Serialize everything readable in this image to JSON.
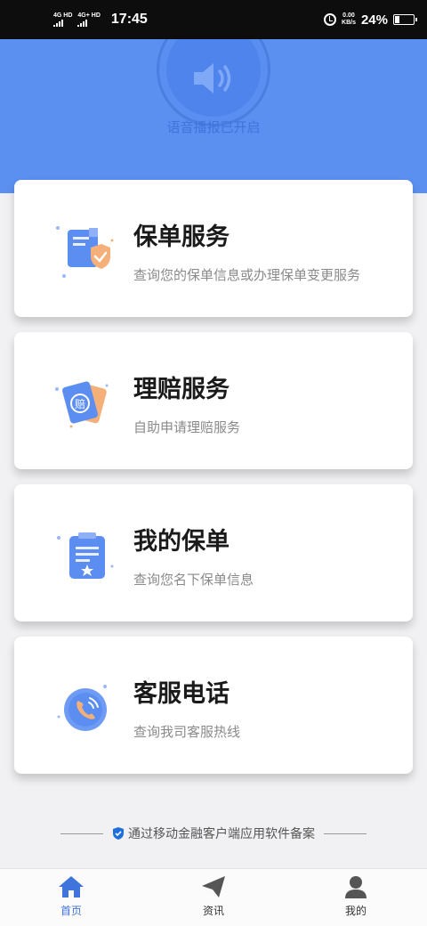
{
  "status_bar": {
    "signal1": "4G HD",
    "signal2": "4G+ HD",
    "time": "17:45",
    "net_speed_value": "0.00",
    "net_speed_unit": "KB/s",
    "battery": "24%",
    "battery_level": 0.24
  },
  "header": {
    "voice_status": "语音播报已开启",
    "icon": "speaker-icon",
    "color": "#5b8ff0"
  },
  "cards": [
    {
      "title": "保单服务",
      "desc": "查询您的保单信息或办理保单变更服务",
      "icon": "policy-shield-icon"
    },
    {
      "title": "理赔服务",
      "desc": "自助申请理赔服务",
      "icon": "claim-icon"
    },
    {
      "title": "我的保单",
      "desc": "查询您名下保单信息",
      "icon": "clipboard-star-icon"
    },
    {
      "title": "客服电话",
      "desc": "查询我司客服热线",
      "icon": "phone-icon"
    }
  ],
  "footer": {
    "note": "通过移动金融客户端应用软件备案",
    "icon": "shield-check-icon"
  },
  "tabs": [
    {
      "label": "首页",
      "icon": "home-icon",
      "active": true
    },
    {
      "label": "资讯",
      "icon": "paper-plane-icon",
      "active": false
    },
    {
      "label": "我的",
      "icon": "user-icon",
      "active": false
    }
  ],
  "colors": {
    "accent": "#3f74dc",
    "header_bg": "#5b8ff0",
    "icon_blue": "#5c8ef2",
    "icon_orange": "#f5b07a"
  }
}
